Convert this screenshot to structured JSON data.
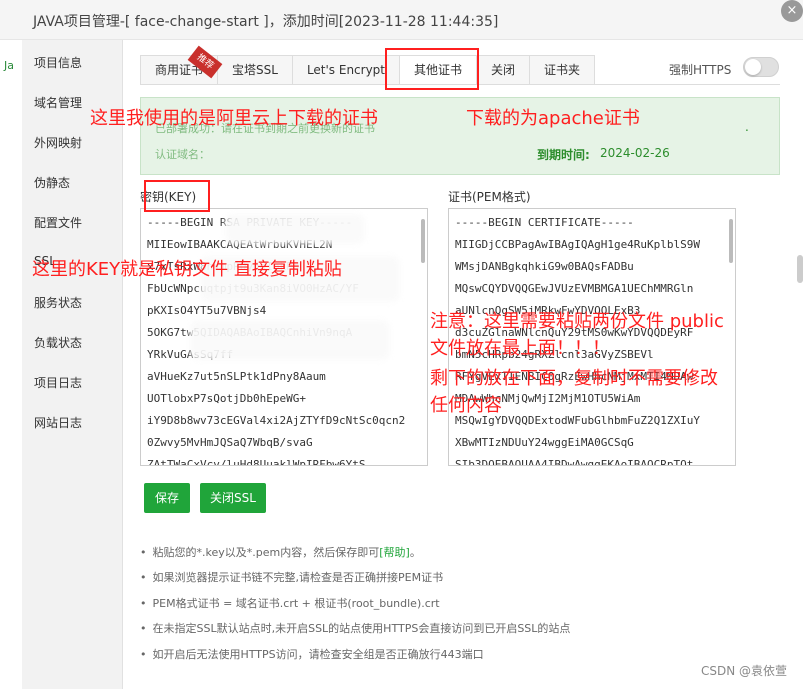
{
  "window": {
    "title": "JAVA项目管理-[ face-change-start ]，添加时间[2023-11-28 11:44:35]",
    "close_glyph": "×"
  },
  "left_strip": {
    "text": "Ja"
  },
  "sidebar": {
    "items": [
      {
        "label": "项目信息"
      },
      {
        "label": "域名管理"
      },
      {
        "label": "外网映射"
      },
      {
        "label": "伪静态"
      },
      {
        "label": "配置文件"
      },
      {
        "label": "SSL"
      },
      {
        "label": "服务状态"
      },
      {
        "label": "负载状态"
      },
      {
        "label": "项目日志"
      },
      {
        "label": "网站日志"
      }
    ]
  },
  "tabs": [
    {
      "label": "商用证书"
    },
    {
      "label": "宝塔SSL"
    },
    {
      "label": "Let's Encrypt"
    },
    {
      "label": "其他证书",
      "active": true
    },
    {
      "label": "关闭"
    },
    {
      "label": "证书夹"
    }
  ],
  "ribbon": "推荐",
  "https_toggle": {
    "label": "强制HTTPS",
    "on": false
  },
  "info": {
    "deployed": "已部署成功：请在证书到期之前更换新的证书",
    "domain": "认证域名：",
    "expiry_label": "到期时间:",
    "expiry_date": "2024-02-26",
    "trailing": "."
  },
  "key_section": {
    "label": "密钥(KEY)",
    "lines": [
      "-----BEGIN RSA PRIVATE KEY-----",
      "MIIEowIBAAKCAQEAtWrbuKVHEL2N",
      "x7xTsRxW8hVmpROy6dIpkPd",
      "FbUcWNpcuqtpjt9u3Kan8iVO0HzAC/YF",
      "pKXIsO4YT5u7VBNjs4",
      "5OKG7tw5QIDAQABAoIBAQCnhiVn9nqA",
      "YRkVuGAsSq7ff",
      "aVHueKz7ut5nSLPtk1dPny8Aaum",
      "UOTlobxP7sQotjDb0hEpeWG+",
      "iY9D8b8wv73cEGVal4xi2AjZTYfD9cNtSc0qcn2",
      "0Zwvy5MvHmJQSaQ7WbqB/svaG",
      "ZAtTWaCxVcv/luHd8UuaklWpIRFbw6YtS"
    ]
  },
  "cert_section": {
    "label": "证书(PEM格式)",
    "lines": [
      "-----BEGIN CERTIFICATE-----",
      "MIIGDjCCBPagAwIBAgIQAgH1ge4RuKplblS9W",
      "WMsjDANBgkqhkiG9w0BAQsFADBu",
      "MQswCQYDVQQGEwJVUzEVMBMGA1UEChMMRGln",
      "aUNlcnQgSW5jMRkwFwYDVQQLExB3",
      "d3cuZGlnaWNlcnQuY29tMS0wKwYDVQQDEyRF",
      "bmN5cHRpb24gRXZlcnl3aGVyZSBEVl",
      "RFYgVExTIENBIC0gRzEwHhcNMjMxMTI4MDAw",
      "MDAwWhcNMjQwMjI2MjM1OTU5WiAm",
      "MSQwIgYDVQQDExtodWFubGlhbmFuZ2Q1ZXIuY",
      "XBwMTIzNDUuY24wggEiMA0GCSqG",
      "SIb3DQEBAQUAA4IBDwAwggEKAoIBAQCRpTOt"
    ]
  },
  "buttons": {
    "save": "保存",
    "close_ssl": "关闭SSL"
  },
  "tips": [
    {
      "text": "粘贴您的*.key以及*.pem内容，然后保存即可",
      "help": "[帮助]",
      "end": "。"
    },
    {
      "text": "如果浏览器提示证书链不完整,请检查是否正确拼接PEM证书"
    },
    {
      "text": "PEM格式证书 = 域名证书.crt + 根证书(root_bundle).crt"
    },
    {
      "text": "在未指定SSL默认站点时,未开启SSL的站点使用HTTPS会直接访问到已开启SSL的站点"
    },
    {
      "text": "如开启后无法使用HTTPS访问，请检查安全组是否正确放行443端口"
    }
  ],
  "annotations": {
    "aliyun": "这里我使用的是阿里云上下载的证书",
    "apache": "下载的为apache证书",
    "key_is_private": "这里的KEY就是私钥文件 直接复制粘贴",
    "note_line1": "注意：这里需要粘贴两份文件 public",
    "note_line2": "文件放在最上面！！！",
    "note_line3": "剩下的放在下面，复制时不需要修改",
    "note_line4": "任何内容"
  },
  "watermark": "CSDN @袁依萱",
  "colors": {
    "green": "#20a53a",
    "annotation_red": "#ff1f1f"
  }
}
